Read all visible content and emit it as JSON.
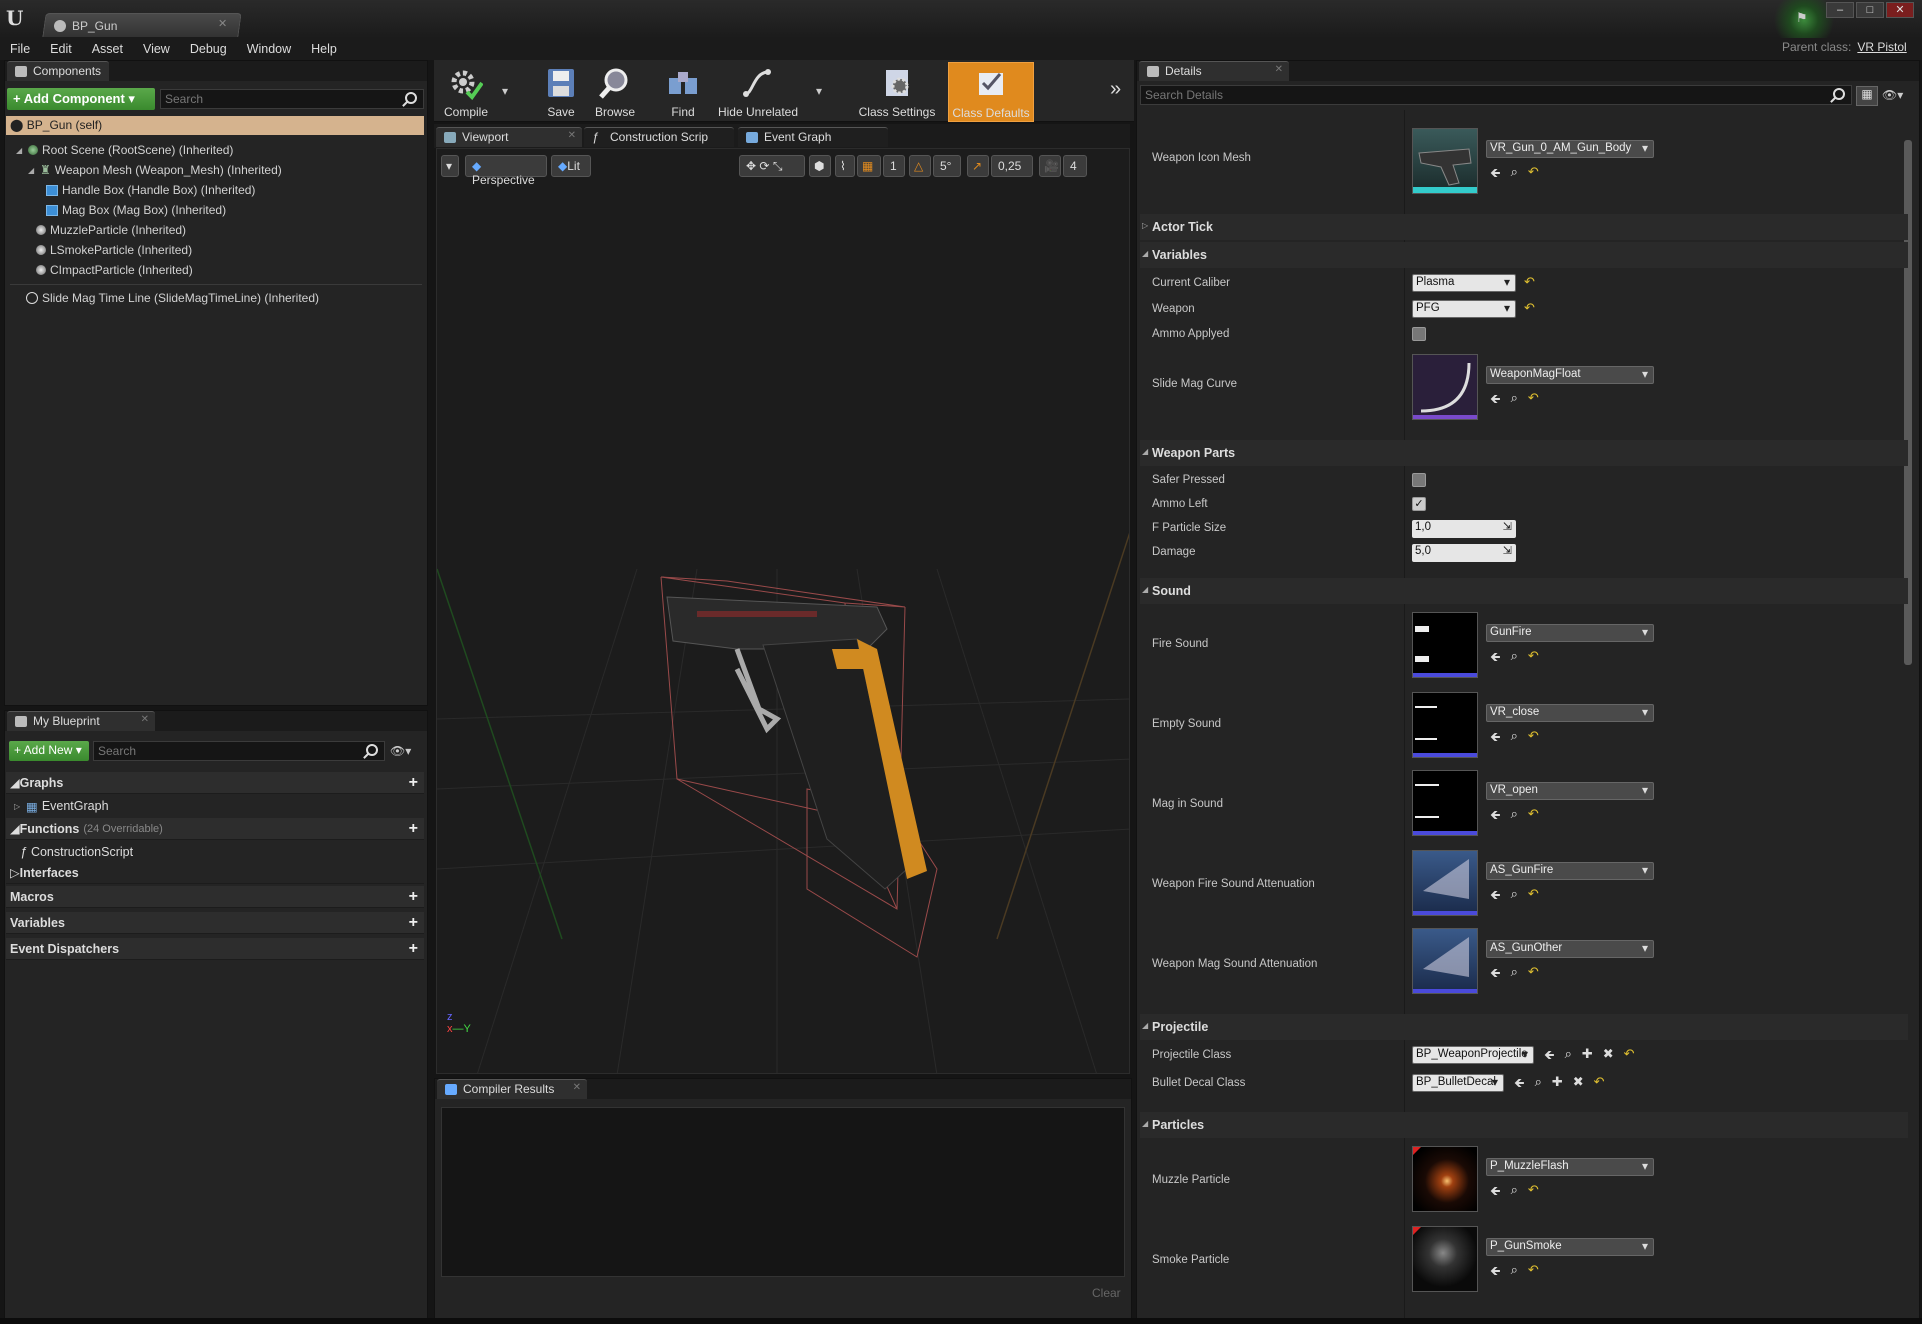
{
  "window": {
    "app_logo": "U",
    "doc_tab": "BP_Gun",
    "parent_class_label": "Parent class:",
    "parent_class": "VR Pistol"
  },
  "menu": [
    "File",
    "Edit",
    "Asset",
    "View",
    "Debug",
    "Window",
    "Help"
  ],
  "components": {
    "tab": "Components",
    "add_label": "+ Add Component ▾",
    "search_placeholder": "Search",
    "self": "BP_Gun (self)",
    "tree": [
      "Root Scene (RootScene) (Inherited)",
      "Weapon Mesh (Weapon_Mesh) (Inherited)",
      "Handle Box (Handle Box) (Inherited)",
      "Mag Box (Mag Box) (Inherited)",
      "MuzzleParticle (Inherited)",
      "LSmokeParticle (Inherited)",
      "CImpactParticle (Inherited)",
      "Slide Mag Time Line (SlideMagTimeLine) (Inherited)"
    ]
  },
  "my_blueprint": {
    "tab": "My Blueprint",
    "add_label": "+ Add New ▾",
    "search_placeholder": "Search",
    "graphs": "Graphs",
    "event_graph": "EventGraph",
    "functions": "Functions",
    "functions_sub": "(24 Overridable)",
    "construction": "ConstructionScript",
    "interfaces": "Interfaces",
    "macros": "Macros",
    "variables": "Variables",
    "dispatchers": "Event Dispatchers"
  },
  "toolbar": {
    "compile": "Compile",
    "save": "Save",
    "browse": "Browse",
    "find": "Find",
    "hide_unrelated": "Hide Unrelated",
    "class_settings": "Class Settings",
    "class_defaults": "Class Defaults"
  },
  "editor_tabs": [
    "Viewport",
    "Construction Scrip",
    "Event Graph"
  ],
  "viewport": {
    "perspective": "Perspective",
    "lit": "Lit",
    "angle": "5°",
    "scale": "0,25",
    "speed": "4",
    "grid": "1"
  },
  "compiler": {
    "tab": "Compiler Results",
    "clear": "Clear"
  },
  "details": {
    "tab": "Details",
    "search_placeholder": "Search Details",
    "weapon_icon_mesh": {
      "label": "Weapon Icon Mesh",
      "value": "VR_Gun_0_AM_Gun_Body"
    },
    "sections": {
      "actor_tick": "Actor Tick",
      "variables": "Variables",
      "weapon_parts": "Weapon Parts",
      "sound": "Sound",
      "projectile": "Projectile",
      "particles": "Particles"
    },
    "current_caliber": {
      "label": "Current Caliber",
      "value": "Plasma"
    },
    "weapon": {
      "label": "Weapon",
      "value": "PFG"
    },
    "ammo_applyed": {
      "label": "Ammo Applyed"
    },
    "slide_mag_curve": {
      "label": "Slide Mag Curve",
      "value": "WeaponMagFloat"
    },
    "safer_pressed": {
      "label": "Safer Pressed",
      "checked": false
    },
    "ammo_left": {
      "label": "Ammo Left",
      "checked": true
    },
    "f_particle_size": {
      "label": "F Particle Size",
      "value": "1,0"
    },
    "damage": {
      "label": "Damage",
      "value": "5,0"
    },
    "fire_sound": {
      "label": "Fire Sound",
      "value": "GunFire"
    },
    "empty_sound": {
      "label": "Empty Sound",
      "value": "VR_close"
    },
    "mag_in_sound": {
      "label": "Mag in Sound",
      "value": "VR_open"
    },
    "fire_atten": {
      "label": "Weapon Fire Sound Attenuation",
      "value": "AS_GunFire"
    },
    "mag_atten": {
      "label": "Weapon Mag Sound Attenuation",
      "value": "AS_GunOther"
    },
    "projectile_class": {
      "label": "Projectile Class",
      "value": "BP_WeaponProjectile"
    },
    "bullet_decal_class": {
      "label": "Bullet Decal Class",
      "value": "BP_BulletDecal"
    },
    "muzzle_particle": {
      "label": "Muzzle Particle",
      "value": "P_MuzzleFlash"
    },
    "smoke_particle": {
      "label": "Smoke Particle",
      "value": "P_GunSmoke"
    }
  },
  "colors": {
    "accent": "#e08a1e",
    "add_green": "#4a9a3a",
    "selection": "#d5b38e"
  }
}
